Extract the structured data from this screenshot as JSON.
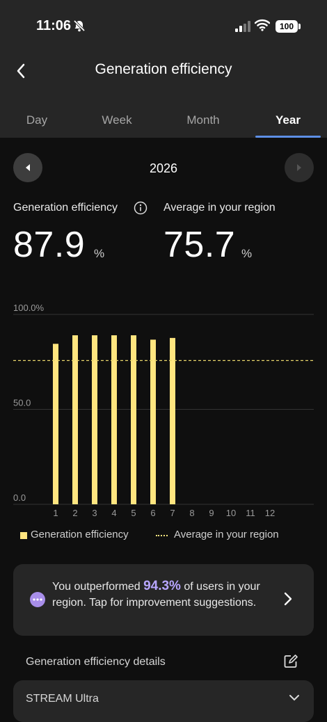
{
  "status_bar": {
    "time": "11:06",
    "battery": "100"
  },
  "header": {
    "title": "Generation efficiency",
    "tabs": [
      {
        "label": "Day"
      },
      {
        "label": "Week"
      },
      {
        "label": "Month"
      },
      {
        "label": "Year",
        "active": true
      }
    ]
  },
  "year_nav": {
    "year": "2026"
  },
  "stats": {
    "efficiency_label": "Generation efficiency",
    "efficiency_value": "87.9",
    "efficiency_unit": "%",
    "region_label": "Average in your region",
    "region_value": "75.7",
    "region_unit": "%"
  },
  "chart_data": {
    "type": "bar",
    "categories": [
      "1",
      "2",
      "3",
      "4",
      "5",
      "6",
      "7",
      "8",
      "9",
      "10",
      "11",
      "12"
    ],
    "series": [
      {
        "name": "Generation efficiency",
        "values": [
          84.5,
          89.0,
          89.0,
          89.0,
          89.0,
          86.7,
          87.6,
          null,
          null,
          null,
          null,
          null
        ]
      }
    ],
    "reference_line": {
      "name": "Average in your region",
      "value": 75.7
    },
    "y_tick_labels": [
      "100.0%",
      "50.0",
      "0.0"
    ],
    "y_ticks": [
      100,
      50,
      0
    ],
    "ylim": [
      0,
      100
    ],
    "grid": true,
    "legend_placement": "bottom",
    "colors": {
      "bar": "#ffe57f",
      "reference": "#e8d66a",
      "grid": "#333333"
    }
  },
  "legend": {
    "efficiency": "Generation efficiency",
    "region": "Average in your region"
  },
  "insight": {
    "before": "You outperformed ",
    "highlight": "94.3%",
    "after": " of users in your region. Tap for improvement suggestions."
  },
  "details": {
    "label": "Generation efficiency details"
  },
  "device": {
    "label": "STREAM Ultra"
  },
  "colors": {
    "accent": "#5d8fe6",
    "bar": "#ffe57f",
    "highlight": "#b8a6ff"
  }
}
